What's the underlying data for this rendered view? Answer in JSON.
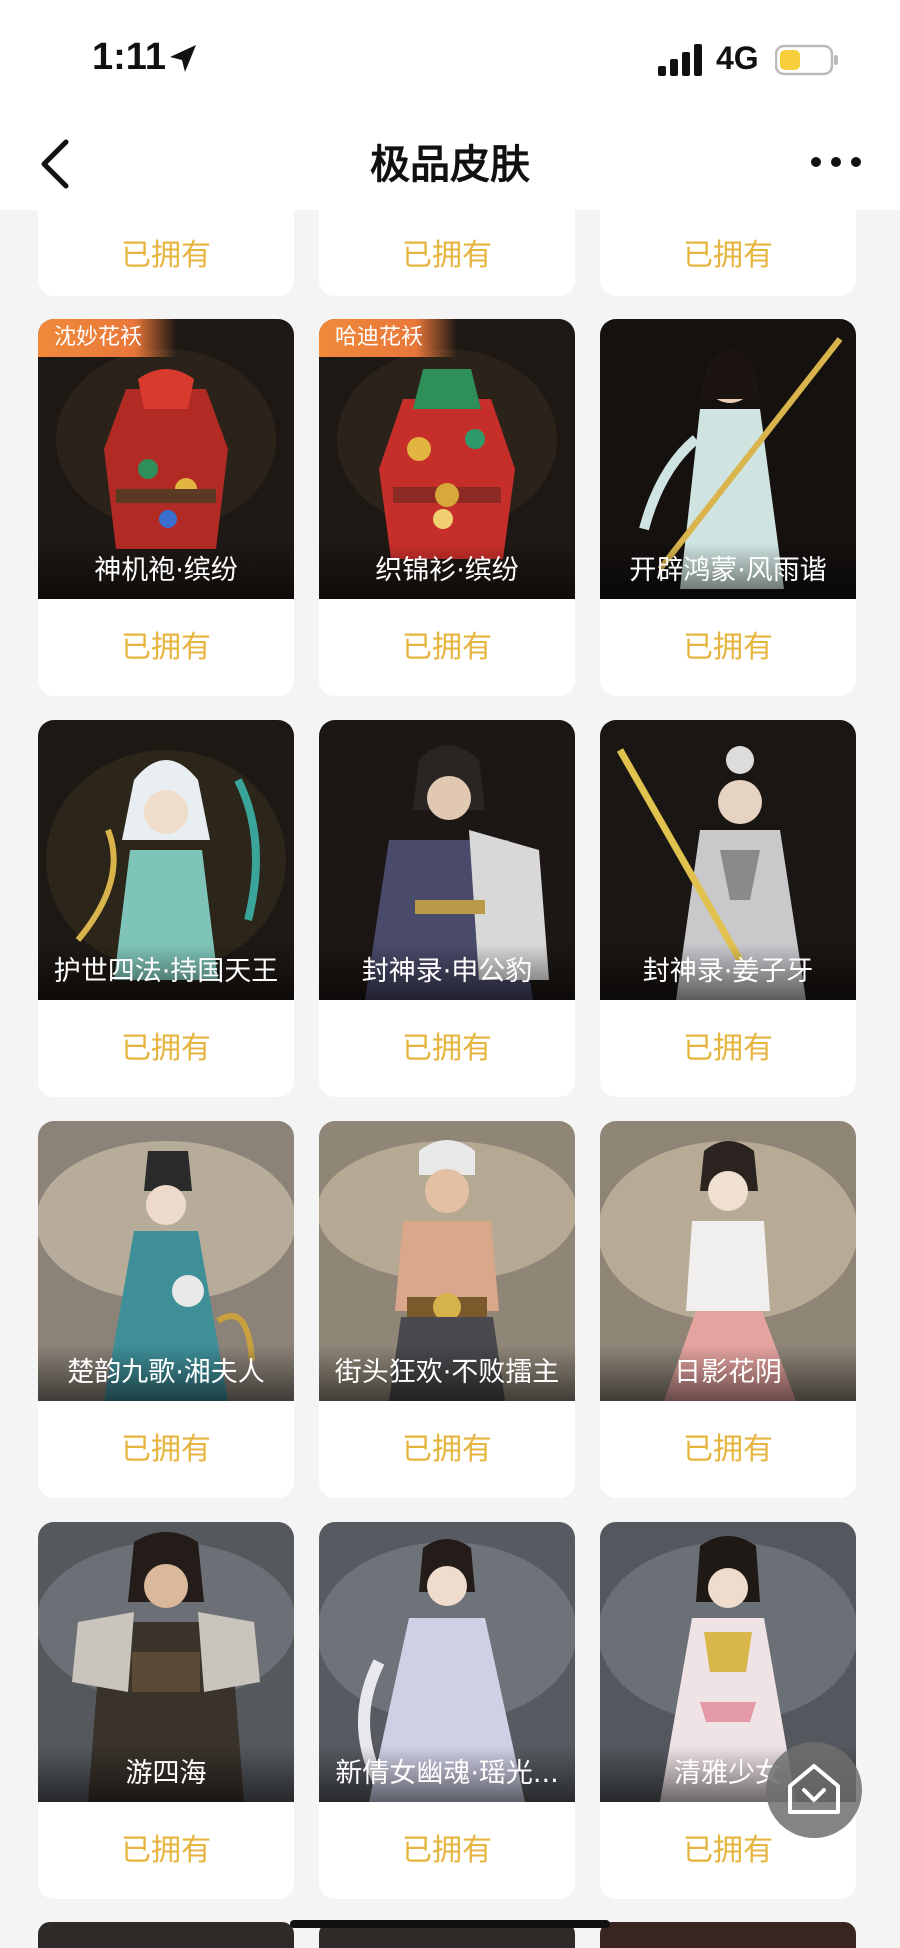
{
  "status_bar": {
    "time": "1:11",
    "network": "4G"
  },
  "nav": {
    "title": "极品皮肤"
  },
  "owned_label": "已拥有",
  "top_partial": [
    "已拥有",
    "已拥有",
    "已拥有"
  ],
  "rows": [
    [
      {
        "name": "神机袍·缤纷",
        "badge": "沈妙花袄"
      },
      {
        "name": "织锦衫·缤纷",
        "badge": "哈迪花袄"
      },
      {
        "name": "开辟鸿蒙·风雨谐",
        "badge": ""
      }
    ],
    [
      {
        "name": "护世四法·持国天王",
        "badge": ""
      },
      {
        "name": "封神录·申公豹",
        "badge": ""
      },
      {
        "name": "封神录·姜子牙",
        "badge": ""
      }
    ],
    [
      {
        "name": "楚韵九歌·湘夫人",
        "badge": ""
      },
      {
        "name": "街头狂欢·不败擂主",
        "badge": ""
      },
      {
        "name": "日影花阴",
        "badge": ""
      }
    ],
    [
      {
        "name": "游四海",
        "badge": ""
      },
      {
        "name": "新倩女幽魂·瑶光...",
        "badge": ""
      },
      {
        "name": "清雅少女",
        "badge": ""
      }
    ]
  ],
  "colors": {
    "accent_gold": "#e6b53f",
    "badge_orange": "#f08a3a",
    "page_bg": "#f4f4f4"
  }
}
